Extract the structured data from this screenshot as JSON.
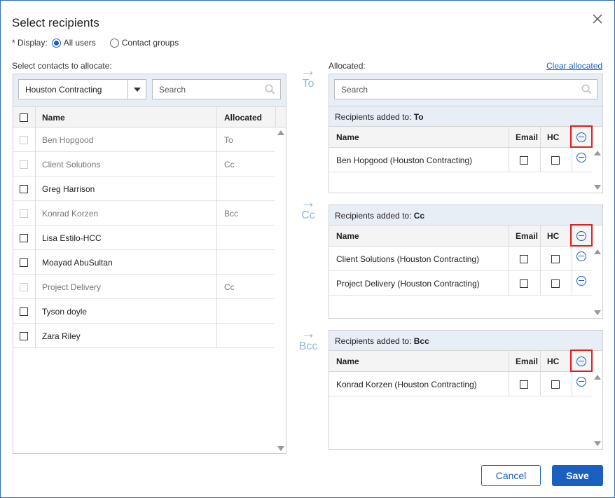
{
  "dialog": {
    "title": "Select recipients"
  },
  "display": {
    "label": "* Display:",
    "options": [
      "All users",
      "Contact groups"
    ],
    "selected": "All users"
  },
  "left": {
    "label": "Select contacts to allocate:",
    "company_select": "Houston Contracting",
    "search_placeholder": "Search",
    "columns": {
      "name": "Name",
      "allocated": "Allocated"
    },
    "rows": [
      {
        "name": "Ben Hopgood",
        "allocated": "To",
        "disabled": true
      },
      {
        "name": "Client Solutions",
        "allocated": "Cc",
        "disabled": true
      },
      {
        "name": "Greg Harrison",
        "allocated": "",
        "disabled": false
      },
      {
        "name": "Konrad Korzen",
        "allocated": "Bcc",
        "disabled": true
      },
      {
        "name": "Lisa Estilo-HCC",
        "allocated": "",
        "disabled": false
      },
      {
        "name": "Moayad AbuSultan",
        "allocated": "",
        "disabled": false
      },
      {
        "name": "Project Delivery",
        "allocated": "Cc",
        "disabled": true
      },
      {
        "name": "Tyson doyle",
        "allocated": "",
        "disabled": false
      },
      {
        "name": "Zara Riley",
        "allocated": "",
        "disabled": false
      }
    ]
  },
  "arrows": {
    "to": "To",
    "cc": "Cc",
    "bcc": "Bcc"
  },
  "right": {
    "label": "Allocated:",
    "clear_link": "Clear allocated",
    "search_placeholder": "Search",
    "section_prefix": "Recipients added to:",
    "columns": {
      "name": "Name",
      "email": "Email",
      "hc": "HC"
    },
    "to": {
      "type": "To",
      "rows": [
        "Ben Hopgood (Houston Contracting)"
      ]
    },
    "cc": {
      "type": "Cc",
      "rows": [
        "Client Solutions (Houston Contracting)",
        "Project Delivery (Houston Contracting)"
      ]
    },
    "bcc": {
      "type": "Bcc",
      "rows": [
        "Konrad Korzen (Houston Contracting)"
      ]
    }
  },
  "buttons": {
    "cancel": "Cancel",
    "save": "Save"
  },
  "colors": {
    "accent": "#1b5fc1",
    "highlight": "#e02020",
    "header_bg": "#e8eef5"
  }
}
